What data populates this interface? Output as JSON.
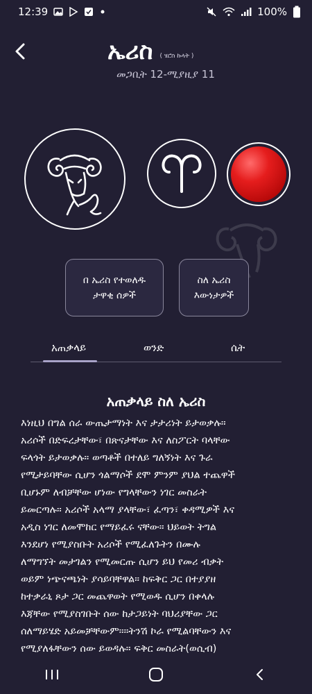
{
  "status_bar": {
    "time": "12:39",
    "battery": "100%",
    "icons": [
      "image-icon",
      "play-store-icon",
      "checkbox-icon",
      "dot-icon",
      "mute-icon",
      "wifi-icon",
      "signal-icon",
      "battery-icon"
    ]
  },
  "header": {
    "title": "ኤሪስ",
    "subtitle": "( ሄሮስ ኩላት )",
    "date_range": "መጋቢት 12-ሚያዚያ 11"
  },
  "zodiac": {
    "planet_color": "#e51d1d",
    "symbol_icon": "aries-symbol-icon",
    "image_icon": "ram-icon"
  },
  "buttons": {
    "famous_line1": "በ ኤሪስ የተወለዱ",
    "famous_line2": "ታዋቂ ሰዎች",
    "facts_line1": "ስለ ኤሪስ",
    "facts_line2": "እውነታዎች"
  },
  "tabs": {
    "general": "አጠቃላይ",
    "male": "ወንድ",
    "female": "ሴት",
    "selected": "general"
  },
  "content": {
    "title": "አጠቃላይ ስለ ኤሪስ",
    "body": " እነዚህ በግል ሰራ ውጤታማነት እና ታታሪነት ይታወቃሉ።\nአሪሶች በድፍረታቸው፣ በጽናታቸው እና ለስፖርት ባላቸው\nፍላጎት ይታወቃሉ። ወጣቶች በተለይ ግለኝነት እና ጉራ\nየሚታይባቸው ሲሆን ጎልማሶች ደሞ ምንም ያህል ተጨዋች\nቢሆኑም ለብቻቸው ሆነው የግላቸውን ነገር መስራት\nይመርጣሉ። አሪሶች አላማ ያላቸው፣ ፈጣን፣ ቀዳሚዎች እና\nአዲስ ነገር ለመሞከር የማይፈሩ ናቸው። ህይወት ትግል\nእንደሆነ የሚያስቡት አሪሶች የሚፈለጉትን በሙሉ\nለማግኘት መታገልን የሚመርጡ ሲሆን ይህ የመሪ ብቃት\nወይም ነጭናጫነት ያሳይባቸዋል። ከፍቅር ጋር በተያያዘ\nከተቃራኒ ጾታ ጋር መጨዋወት የሚወዱ ሲሆን በቀላሉ\nእጃቸው የሚያስገቡት ሰው ከታጋይነት ባህሪያቸው ጋር\nሰለማይሄድ አይመቻቸውም።።ትንሽ ኮራ የሚልባቸውን እና\nየሚያለፋቸውን ሰው ይወዳሉ። ፍቅር መስራት(ወሲብ)\nየሚወዱት አሪሶች ይሄን ስሜታቸውን ቀዝቀዝ የሚያረግ"
  },
  "nav": {
    "recent_icon": "recent-apps-icon",
    "home_icon": "home-icon",
    "back_icon": "back-icon"
  }
}
